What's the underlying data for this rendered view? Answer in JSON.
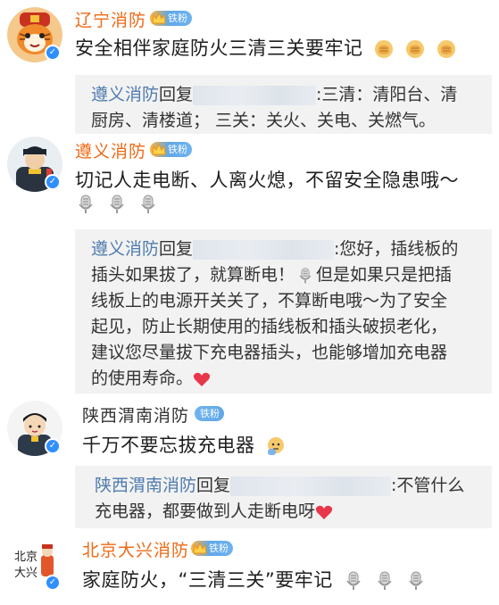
{
  "comments": [
    {
      "name": "辽宁消防",
      "badge": "铁粉",
      "text": "安全相伴家庭防火三清三关要牢记",
      "emoji": "fist-emoji",
      "reply": null
    },
    {
      "name": "遵义消防",
      "badge": "铁粉",
      "text": "切记人走电断、人离火熄，不留安全隐患哦～",
      "emoji": "microphone-emoji",
      "reply": null
    },
    {
      "name": "陕西渭南消防",
      "badge": "铁粉",
      "text": "千万不要忘拔充电器",
      "emoji": "thinking-emoji",
      "reply": null
    },
    {
      "name": "北京大兴消防",
      "badge": "铁粉",
      "text": "家庭防火，“三清三关”要牢记",
      "emoji": "microphone-emoji",
      "reply": null
    }
  ],
  "replies": [
    {
      "name": "遵义消防",
      "verb": "回复",
      "line1": ":三清：清阳台、清",
      "line2": "厨房、清楼道；  三关：关火、关电、关燃气。"
    },
    {
      "name": "遵义消防",
      "verb": "回复",
      "line1": ":您好，插线板的",
      "line2": "插头如果拔了，就算断电！",
      "line2b": "但是如果只是把插",
      "line3": "线板上的电源开关关了，不算断电哦～为了安全",
      "line4": "起见，防止长期使用的插线板和插头破损老化，",
      "line5": "建议您尽量拔下充电器插头，也能够增加充电器",
      "line6": "的使用寿命。"
    },
    {
      "name": "陕西渭南消防",
      "verb": "回复",
      "line1": ":不管什么",
      "line2": "充电器，都要做到人走断电呀"
    }
  ],
  "colors": {
    "name_orange": "#ef6a16",
    "reply_name_blue": "#4f7cae",
    "reply_bg": "#f2f2f2",
    "verified_blue": "#2f8fff"
  }
}
